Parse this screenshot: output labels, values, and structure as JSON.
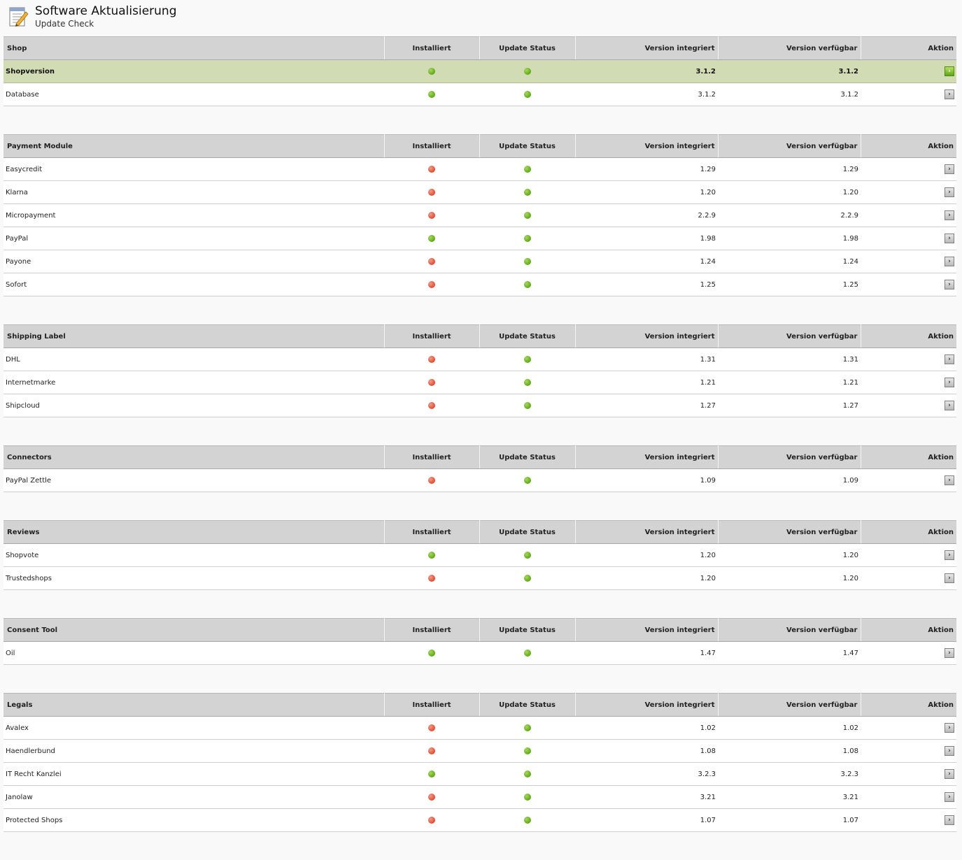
{
  "header": {
    "title": "Software Aktualisierung",
    "subtitle": "Update Check",
    "icon": "edit-document-icon"
  },
  "columns": {
    "installed": "Installiert",
    "update_status": "Update Status",
    "version_integrated": "Version integriert",
    "version_available": "Version verfügbar",
    "action": "Aktion"
  },
  "colors": {
    "status_ok": "#5fa818",
    "status_missing": "#df4a33",
    "highlight_row": "#d1dcb4",
    "header_row": "#d3d3d3"
  },
  "sections": [
    {
      "title": "Shop",
      "rows": [
        {
          "name": "Shopversion",
          "installed": "green",
          "status": "green",
          "v_int": "3.1.2",
          "v_avail": "3.1.2",
          "highlight": true
        },
        {
          "name": "Database",
          "installed": "green",
          "status": "green",
          "v_int": "3.1.2",
          "v_avail": "3.1.2"
        }
      ]
    },
    {
      "title": "Payment Module",
      "rows": [
        {
          "name": "Easycredit",
          "installed": "red",
          "status": "green",
          "v_int": "1.29",
          "v_avail": "1.29"
        },
        {
          "name": "Klarna",
          "installed": "red",
          "status": "green",
          "v_int": "1.20",
          "v_avail": "1.20"
        },
        {
          "name": "Micropayment",
          "installed": "red",
          "status": "green",
          "v_int": "2.2.9",
          "v_avail": "2.2.9"
        },
        {
          "name": "PayPal",
          "installed": "green",
          "status": "green",
          "v_int": "1.98",
          "v_avail": "1.98"
        },
        {
          "name": "Payone",
          "installed": "red",
          "status": "green",
          "v_int": "1.24",
          "v_avail": "1.24"
        },
        {
          "name": "Sofort",
          "installed": "red",
          "status": "green",
          "v_int": "1.25",
          "v_avail": "1.25"
        }
      ]
    },
    {
      "title": "Shipping Label",
      "rows": [
        {
          "name": "DHL",
          "installed": "red",
          "status": "green",
          "v_int": "1.31",
          "v_avail": "1.31"
        },
        {
          "name": "Internetmarke",
          "installed": "red",
          "status": "green",
          "v_int": "1.21",
          "v_avail": "1.21"
        },
        {
          "name": "Shipcloud",
          "installed": "red",
          "status": "green",
          "v_int": "1.27",
          "v_avail": "1.27"
        }
      ]
    },
    {
      "title": "Connectors",
      "rows": [
        {
          "name": "PayPal Zettle",
          "installed": "red",
          "status": "green",
          "v_int": "1.09",
          "v_avail": "1.09"
        }
      ]
    },
    {
      "title": "Reviews",
      "rows": [
        {
          "name": "Shopvote",
          "installed": "green",
          "status": "green",
          "v_int": "1.20",
          "v_avail": "1.20"
        },
        {
          "name": "Trustedshops",
          "installed": "red",
          "status": "green",
          "v_int": "1.20",
          "v_avail": "1.20"
        }
      ]
    },
    {
      "title": "Consent Tool",
      "rows": [
        {
          "name": "Oil",
          "installed": "green",
          "status": "green",
          "v_int": "1.47",
          "v_avail": "1.47"
        }
      ]
    },
    {
      "title": "Legals",
      "rows": [
        {
          "name": "Avalex",
          "installed": "red",
          "status": "green",
          "v_int": "1.02",
          "v_avail": "1.02"
        },
        {
          "name": "Haendlerbund",
          "installed": "red",
          "status": "green",
          "v_int": "1.08",
          "v_avail": "1.08"
        },
        {
          "name": "IT Recht Kanzlei",
          "installed": "green",
          "status": "green",
          "v_int": "3.2.3",
          "v_avail": "3.2.3"
        },
        {
          "name": "Janolaw",
          "installed": "red",
          "status": "green",
          "v_int": "3.21",
          "v_avail": "3.21"
        },
        {
          "name": "Protected Shops",
          "installed": "red",
          "status": "green",
          "v_int": "1.07",
          "v_avail": "1.07"
        }
      ]
    }
  ]
}
